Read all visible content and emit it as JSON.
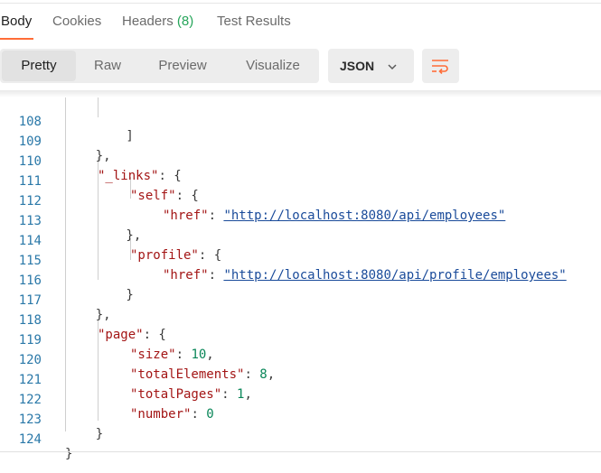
{
  "tabs": [
    {
      "label": "Body"
    },
    {
      "label": "Cookies"
    },
    {
      "label": "Headers",
      "count": "(8)"
    },
    {
      "label": "Test Results"
    }
  ],
  "view_modes": [
    {
      "label": "Pretty"
    },
    {
      "label": "Raw"
    },
    {
      "label": "Preview"
    },
    {
      "label": "Visualize"
    }
  ],
  "format_select": {
    "value": "JSON",
    "icon": "chevron-down-icon"
  },
  "wrap_button": {
    "icon": "wrap-lines-icon"
  },
  "colors": {
    "accent": "#ff6c37",
    "count": "#26a55a",
    "line_numbers": "#2a78a8"
  },
  "code_lines": [
    {
      "n": "108",
      "t": "        ]"
    },
    {
      "n": "109",
      "t": "    },"
    },
    {
      "n": "110",
      "key": "\"_links\"",
      "t2": ": {"
    },
    {
      "n": "111",
      "key": "\"self\"",
      "t2": ": {"
    },
    {
      "n": "112",
      "key": "\"href\"",
      "t2": ": ",
      "url": "\"http://localhost:8080/api/employees\""
    },
    {
      "n": "113",
      "t": "        },"
    },
    {
      "n": "114",
      "key": "\"profile\"",
      "t2": ": {"
    },
    {
      "n": "115",
      "key": "\"href\"",
      "t2": ": ",
      "url": "\"http://localhost:8080/api/profile/employees\""
    },
    {
      "n": "116",
      "t": "        }"
    },
    {
      "n": "117",
      "t": "    },"
    },
    {
      "n": "118",
      "key": "\"page\"",
      "t2": ": {"
    },
    {
      "n": "119",
      "key": "\"size\"",
      "t2": ": ",
      "num": "10",
      "t3": ","
    },
    {
      "n": "120",
      "key": "\"totalElements\"",
      "t2": ": ",
      "num": "8",
      "t3": ","
    },
    {
      "n": "121",
      "key": "\"totalPages\"",
      "t2": ": ",
      "num": "1",
      "t3": ","
    },
    {
      "n": "122",
      "key": "\"number\"",
      "t2": ": ",
      "num": "0",
      "t3": ""
    },
    {
      "n": "123",
      "t": "    }"
    },
    {
      "n": "124",
      "t": "}"
    }
  ]
}
